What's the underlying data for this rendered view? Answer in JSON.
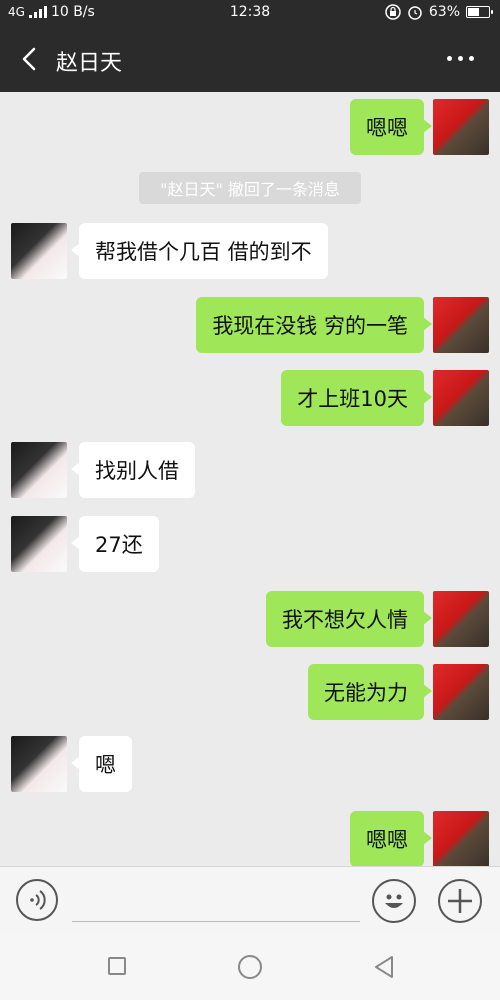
{
  "status_bar": {
    "network": "4G",
    "speed": "10 B/s",
    "time": "12:38",
    "battery": "63%",
    "battery_level": 0.63
  },
  "header": {
    "title": "赵日天",
    "back_icon": "back-arrow-icon",
    "more_icon": "more-icon"
  },
  "messages": [
    {
      "side": "self",
      "text": "嗯嗯"
    },
    {
      "side": "system",
      "text": "\"赵日天\" 撤回了一条消息"
    },
    {
      "side": "other",
      "text": "帮我借个几百  借的到不"
    },
    {
      "side": "self",
      "text": "我现在没钱  穷的一笔"
    },
    {
      "side": "self",
      "text": "才上班10天"
    },
    {
      "side": "other",
      "text": "找别人借"
    },
    {
      "side": "other",
      "text": "27还"
    },
    {
      "side": "self",
      "text": "我不想欠人情"
    },
    {
      "side": "self",
      "text": "无能为力"
    },
    {
      "side": "other",
      "text": "嗯"
    },
    {
      "side": "self",
      "text": "嗯嗯"
    }
  ],
  "input_bar": {
    "voice_icon": "voice-icon",
    "emoji_icon": "emoji-icon",
    "plus_icon": "plus-icon",
    "text_value": ""
  },
  "nav_bar": {
    "recent_icon": "square-icon",
    "home_icon": "circle-icon",
    "back_icon": "triangle-back-icon"
  }
}
